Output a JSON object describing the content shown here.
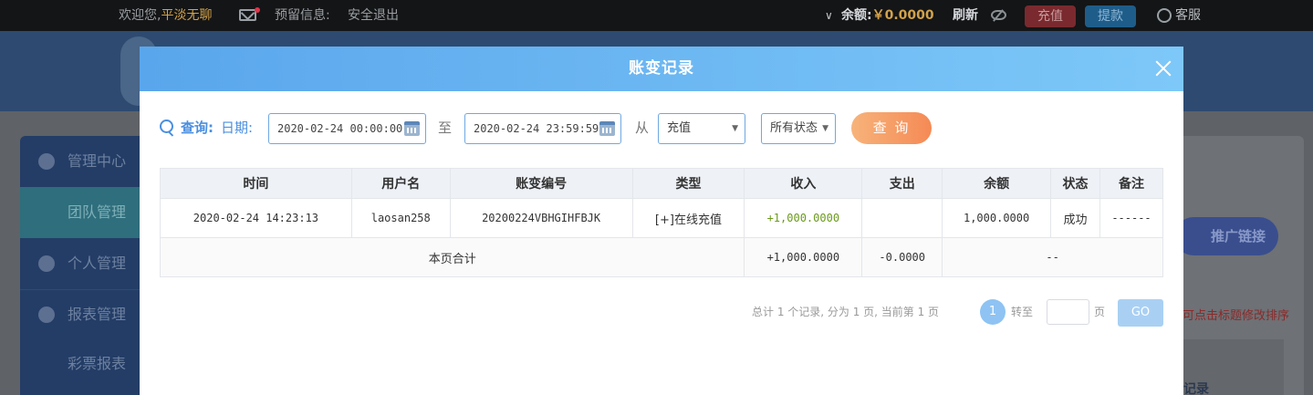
{
  "topbar": {
    "welcome_prefix": "欢迎您,",
    "username": "平淡无聊",
    "reserve_info": "预留信息:",
    "logout": "安全退出",
    "chevron": "∨",
    "balance_label": "余额:",
    "balance_amount": "￥0.0000",
    "refresh": "刷新",
    "recharge": "充值",
    "withdraw": "提款",
    "service": "客服"
  },
  "sidebar": {
    "items": [
      {
        "label": "管理中心",
        "icon": "users-icon"
      },
      {
        "label": "团队管理"
      },
      {
        "label": "个人管理",
        "icon": "user-icon"
      },
      {
        "label": "报表管理",
        "icon": "report-icon"
      },
      {
        "label": "彩票报表"
      }
    ]
  },
  "background": {
    "promo_button": "推广链接",
    "sort_hint": "可点击标题修改排序",
    "right_link": "记录"
  },
  "modal": {
    "title": "账变记录",
    "query": {
      "label": "查询:",
      "date_label": "日期:",
      "start_date": "2020-02-24 00:00:00",
      "to_label": "至",
      "end_date": "2020-02-24 23:59:59",
      "from_label": "从",
      "type_select": "充值",
      "status_select": "所有状态",
      "query_button": "查 询"
    },
    "table": {
      "headers": [
        "时间",
        "用户名",
        "账变编号",
        "类型",
        "收入",
        "支出",
        "余额",
        "状态",
        "备注"
      ],
      "rows": [
        {
          "time": "2020-02-24 14:23:13",
          "username": "laosan258",
          "number": "20200224VBHGIHFBJK",
          "type": "[+]在线充值",
          "income": "+1,000.0000",
          "expense": "",
          "balance": "1,000.0000",
          "status": "成功",
          "remark": "------"
        }
      ],
      "total": {
        "label": "本页合计",
        "income": "+1,000.0000",
        "expense": "-0.0000",
        "balance": "--"
      }
    },
    "pager": {
      "summary": "总计 1 个记录, 分为 1 页, 当前第 1 页",
      "current_page": "1",
      "goto_label": "转至",
      "page_suffix": "页",
      "go_button": "GO"
    }
  }
}
